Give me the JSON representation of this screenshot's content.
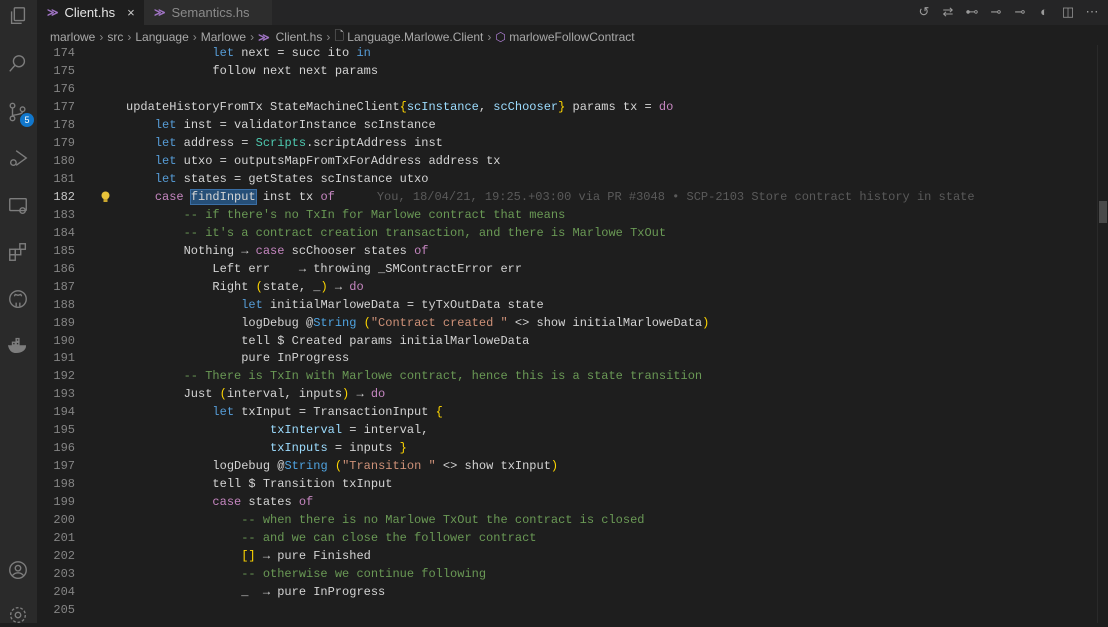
{
  "activity_bar": {
    "items": [
      {
        "name": "explorer-icon"
      },
      {
        "name": "search-icon"
      },
      {
        "name": "source-control-icon",
        "badge": "5"
      },
      {
        "name": "run-debug-icon"
      },
      {
        "name": "remote-explorer-icon"
      },
      {
        "name": "extensions-icon"
      },
      {
        "name": "github-icon"
      },
      {
        "name": "docker-icon"
      },
      {
        "name": "account-icon"
      },
      {
        "name": "settings-gear-icon"
      }
    ]
  },
  "tabs": [
    {
      "label": "Client.hs",
      "active": true,
      "close": "×"
    },
    {
      "label": "Semantics.hs",
      "active": false
    }
  ],
  "toolbar": [
    "timeline-icon",
    "compare-changes-icon",
    "git-commit-icon",
    "previous-change-icon",
    "next-change-icon",
    "gitlens-icon",
    "split-editor-icon",
    "more-actions-icon"
  ],
  "breadcrumb": [
    "marlowe",
    "src",
    "Language",
    "Marlowe",
    "Client.hs",
    "Language.Marlowe.Client",
    "marloweFollowContract"
  ],
  "editor": {
    "current_line": "182",
    "blame": "You, 18/04/21, 19:25.+03:00 via PR #3048 • SCP-2103 Store contract history in state",
    "lines": [
      {
        "n": "174",
        "tokens": [
          [
            "            "
          ],
          [
            "let",
            "l"
          ],
          [
            " next = succ ito "
          ],
          [
            "in",
            "l"
          ]
        ]
      },
      {
        "n": "175",
        "tokens": [
          [
            "            follow next next params"
          ]
        ]
      },
      {
        "n": "176",
        "tokens": []
      },
      {
        "n": "177",
        "tokens": [
          [
            "updateHistoryFromTx StateMachineClient"
          ],
          [
            "{",
            "b"
          ],
          [
            "scInstance",
            "v"
          ],
          [
            ", "
          ],
          [
            "scChooser",
            "v"
          ],
          [
            "}",
            "b"
          ],
          [
            " params tx = "
          ],
          [
            "do",
            "k"
          ]
        ]
      },
      {
        "n": "178",
        "tokens": [
          [
            "    "
          ],
          [
            "let",
            "l"
          ],
          [
            " inst = validatorInstance scInstance"
          ]
        ]
      },
      {
        "n": "179",
        "tokens": [
          [
            "    "
          ],
          [
            "let",
            "l"
          ],
          [
            " address = "
          ],
          [
            "Scripts",
            "t"
          ],
          [
            ".scriptAddress inst"
          ]
        ]
      },
      {
        "n": "180",
        "tokens": [
          [
            "    "
          ],
          [
            "let",
            "l"
          ],
          [
            " utxo = outputsMapFromTxForAddress address tx"
          ]
        ]
      },
      {
        "n": "181",
        "tokens": [
          [
            "    "
          ],
          [
            "let",
            "l"
          ],
          [
            " states = getStates scInstance utxo"
          ]
        ]
      },
      {
        "n": "182",
        "tokens": [
          [
            "    "
          ],
          [
            "case",
            "k"
          ],
          [
            " "
          ],
          [
            "findInput",
            "sel"
          ],
          [
            " inst tx "
          ],
          [
            "of",
            "k"
          ]
        ],
        "blame": true
      },
      {
        "n": "183",
        "tokens": [
          [
            "        "
          ],
          [
            "-- if there's no TxIn for Marlowe contract that means",
            "c"
          ]
        ]
      },
      {
        "n": "184",
        "tokens": [
          [
            "        "
          ],
          [
            "-- it's a contract creation transaction, and there is Marlowe TxOut",
            "c"
          ]
        ]
      },
      {
        "n": "185",
        "tokens": [
          [
            "        Nothing → "
          ],
          [
            "case",
            "k"
          ],
          [
            " scChooser states "
          ],
          [
            "of",
            "k"
          ]
        ]
      },
      {
        "n": "186",
        "tokens": [
          [
            "            Left err    → throwing _SMContractError err"
          ]
        ]
      },
      {
        "n": "187",
        "tokens": [
          [
            "            Right "
          ],
          [
            "(",
            "b"
          ],
          [
            "state, _"
          ],
          [
            ")",
            "b"
          ],
          [
            " → "
          ],
          [
            "do",
            "k"
          ]
        ]
      },
      {
        "n": "188",
        "tokens": [
          [
            "                "
          ],
          [
            "let",
            "l"
          ],
          [
            " initialMarloweData = tyTxOutData state"
          ]
        ]
      },
      {
        "n": "189",
        "tokens": [
          [
            "                logDebug @"
          ],
          [
            "String",
            "ty"
          ],
          [
            " "
          ],
          [
            "(",
            "b"
          ],
          [
            "\"Contract created \"",
            "s"
          ],
          [
            " <> show initialMarloweData"
          ],
          [
            ")",
            "b"
          ]
        ]
      },
      {
        "n": "190",
        "tokens": [
          [
            "                tell $ Created params initialMarloweData"
          ]
        ]
      },
      {
        "n": "191",
        "tokens": [
          [
            "                pure InProgress"
          ]
        ]
      },
      {
        "n": "192",
        "tokens": [
          [
            "        "
          ],
          [
            "-- There is TxIn with Marlowe contract, hence this is a state transition",
            "c"
          ]
        ]
      },
      {
        "n": "193",
        "tokens": [
          [
            "        Just "
          ],
          [
            "(",
            "b"
          ],
          [
            "interval, inputs"
          ],
          [
            ")",
            "b"
          ],
          [
            " → "
          ],
          [
            "do",
            "k"
          ]
        ]
      },
      {
        "n": "194",
        "tokens": [
          [
            "            "
          ],
          [
            "let",
            "l"
          ],
          [
            " txInput = TransactionInput "
          ],
          [
            "{",
            "b"
          ]
        ]
      },
      {
        "n": "195",
        "tokens": [
          [
            "                    "
          ],
          [
            "txInterval",
            "v"
          ],
          [
            " = interval,"
          ]
        ]
      },
      {
        "n": "196",
        "tokens": [
          [
            "                    "
          ],
          [
            "txInputs",
            "v"
          ],
          [
            " = inputs "
          ],
          [
            "}",
            "b"
          ]
        ]
      },
      {
        "n": "197",
        "tokens": [
          [
            "            logDebug @"
          ],
          [
            "String",
            "ty"
          ],
          [
            " "
          ],
          [
            "(",
            "b"
          ],
          [
            "\"Transition \"",
            "s"
          ],
          [
            " <> show txInput"
          ],
          [
            ")",
            "b"
          ]
        ]
      },
      {
        "n": "198",
        "tokens": [
          [
            "            tell $ Transition txInput"
          ]
        ]
      },
      {
        "n": "199",
        "tokens": [
          [
            "            "
          ],
          [
            "case",
            "k"
          ],
          [
            " states "
          ],
          [
            "of",
            "k"
          ]
        ]
      },
      {
        "n": "200",
        "tokens": [
          [
            "                "
          ],
          [
            "-- when there is no Marlowe TxOut the contract is closed",
            "c"
          ]
        ]
      },
      {
        "n": "201",
        "tokens": [
          [
            "                "
          ],
          [
            "-- and we can close the follower contract",
            "c"
          ]
        ]
      },
      {
        "n": "202",
        "tokens": [
          [
            "                "
          ],
          [
            "[]",
            "b"
          ],
          [
            " → pure Finished"
          ]
        ]
      },
      {
        "n": "203",
        "tokens": [
          [
            "                "
          ],
          [
            "-- otherwise we continue following",
            "c"
          ]
        ]
      },
      {
        "n": "204",
        "tokens": [
          [
            "                _  → pure InProgress"
          ]
        ]
      },
      {
        "n": "205",
        "tokens": []
      }
    ]
  }
}
